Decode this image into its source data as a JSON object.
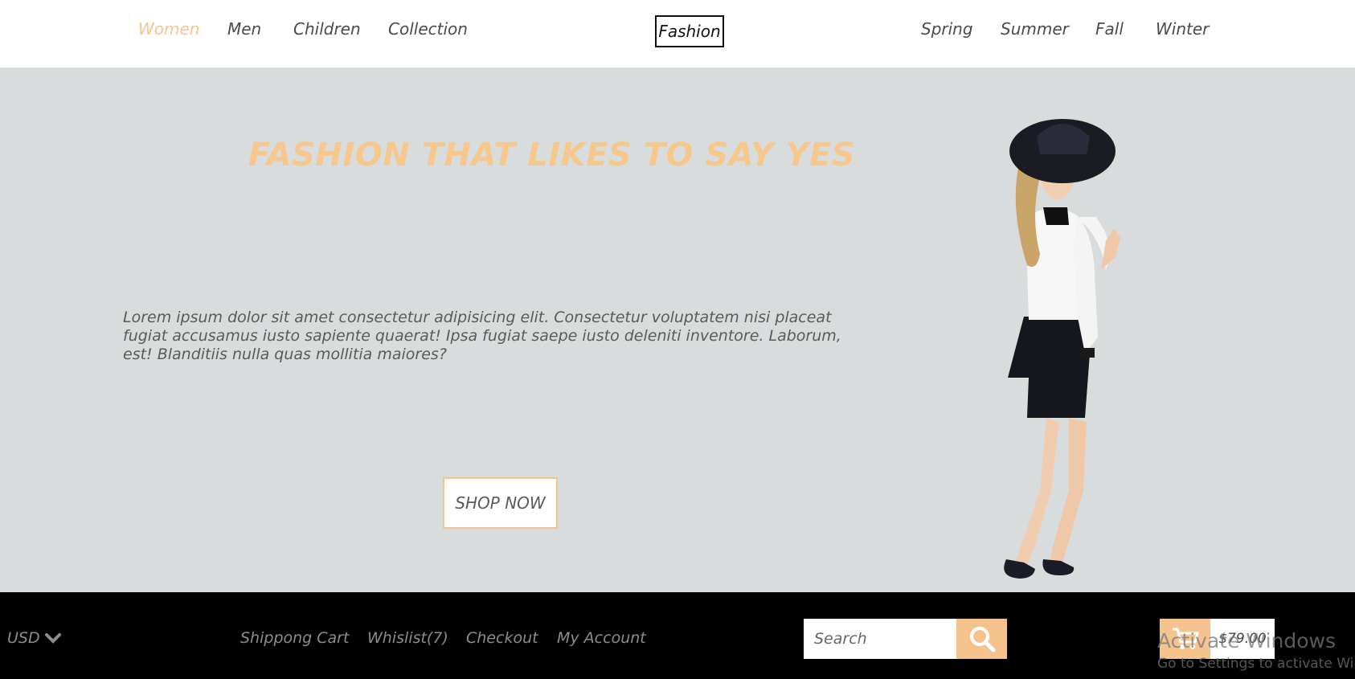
{
  "nav": {
    "left": [
      "Women",
      "Men",
      "Children",
      "Collection"
    ],
    "brand": "Fashion",
    "right": [
      "Spring",
      "Summer",
      "Fall",
      "Winter"
    ],
    "active": "Women"
  },
  "hero": {
    "title": "FASHION THAT LIKES TO SAY YES",
    "text": "Lorem ipsum dolor sit amet consectetur adipisicing elit. Consectetur voluptatem nisi placeat fugiat accusamus iusto sapiente quaerat! Ipsa fugiat saepe iusto deleniti inventore. Laborum, est! Blanditiis nulla quas mollitia maiores?",
    "button": "SHOP NOW"
  },
  "footer": {
    "currency": "USD",
    "links": [
      "Shippong Cart",
      "Whislist(7)",
      "Checkout",
      "My Account"
    ],
    "search_placeholder": "Search",
    "cart_total": "$79.00"
  },
  "watermark": {
    "title": "Activate Windows",
    "subtitle": "Go to Settings to activate Windows."
  },
  "colors": {
    "accent": "#f5c48e",
    "hero_bg": "#d9dcdd",
    "footer_bg": "#000000"
  },
  "icons": {
    "currency_toggle": "chevron-down-icon",
    "search": "search-icon",
    "cart": "cart-icon"
  }
}
